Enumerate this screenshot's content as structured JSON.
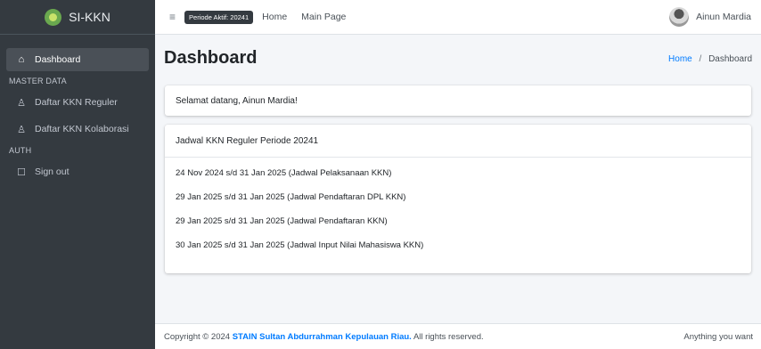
{
  "sidebar": {
    "brand": "SI-KKN",
    "items": [
      {
        "label": "Dashboard",
        "icon": "home-icon"
      },
      {
        "label": "Daftar KKN Reguler",
        "icon": "user-icon"
      },
      {
        "label": "Daftar KKN Kolaborasi",
        "icon": "users-icon"
      },
      {
        "label": "Sign out",
        "icon": "sign-out-icon"
      }
    ],
    "headers": [
      "MASTER DATA",
      "AUTH"
    ]
  },
  "topbar": {
    "periode_badge": "Periode Aktif: 20241",
    "links": [
      "Home",
      "Main Page"
    ],
    "user_name": "Ainun Mardia"
  },
  "page": {
    "title": "Dashboard",
    "breadcrumb": [
      "Home",
      "/",
      "Dashboard"
    ]
  },
  "welcome": "Selamat datang, Ainun Mardia!",
  "schedule": {
    "title": "Jadwal KKN Reguler Periode 20241",
    "items": [
      "24 Nov 2024 s/d 31 Jan 2025 (Jadwal Pelaksanaan KKN)",
      "29 Jan 2025 s/d 31 Jan 2025 (Jadwal Pendaftaran DPL KKN)",
      "29 Jan 2025 s/d 31 Jan 2025 (Jadwal Pendaftaran KKN)",
      "30 Jan 2025 s/d 31 Jan 2025 (Jadwal Input Nilai Mahasiswa KKN)"
    ]
  },
  "footer": {
    "copyright": "Copyright © 2024",
    "institution": "STAIN Sultan Abdurrahman Kepulauan Riau.",
    "rights": "All rights reserved.",
    "right_text": "Anything you want"
  },
  "colors": {
    "sidebar_bg": "#343a40",
    "accent": "#007bff",
    "page_bg": "#f4f6f9"
  }
}
